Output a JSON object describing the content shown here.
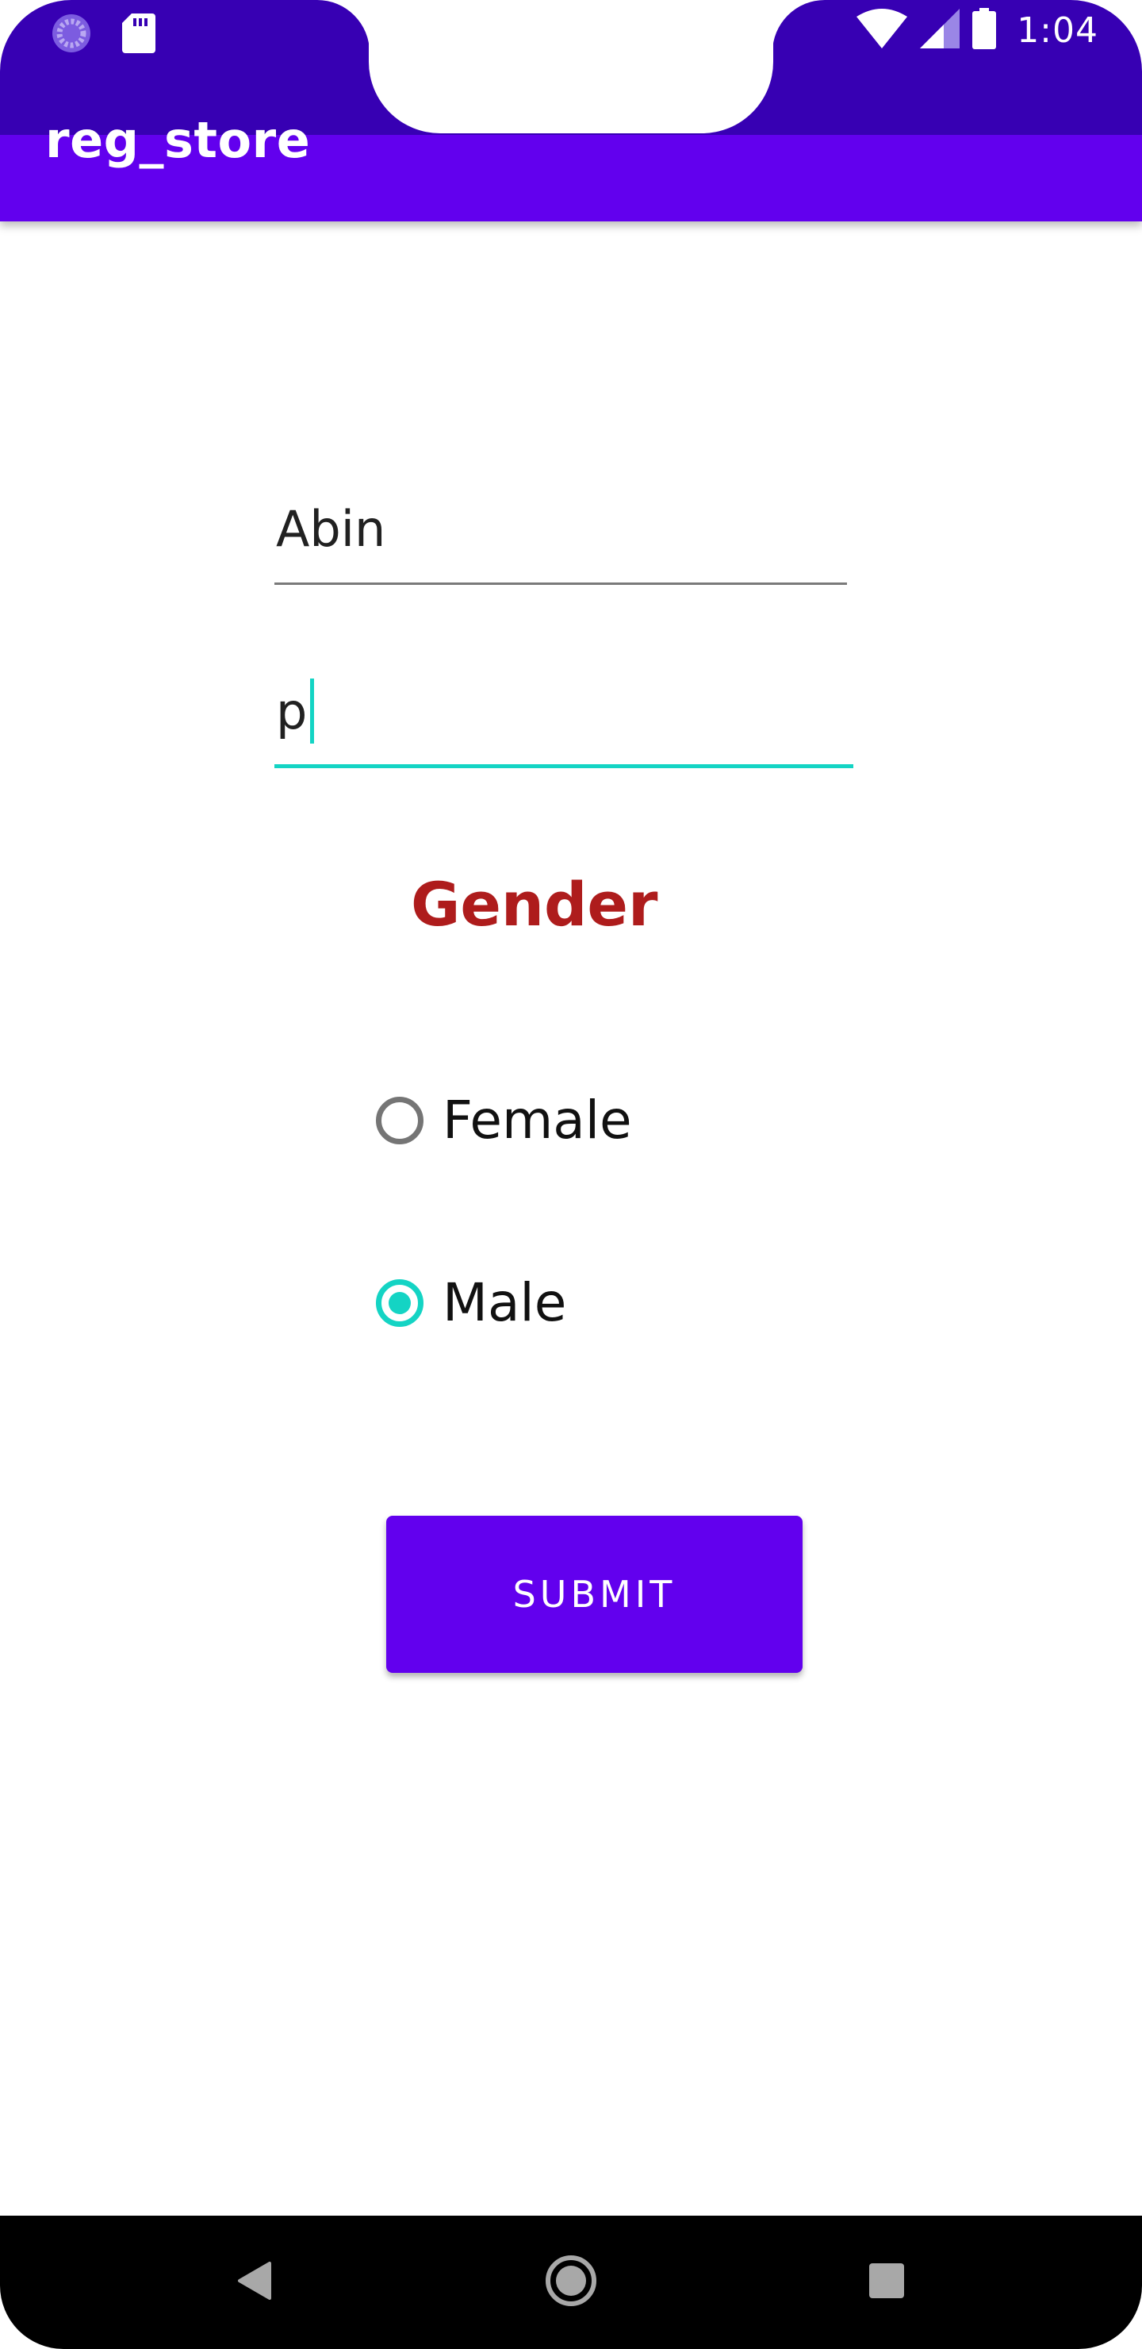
{
  "status_bar": {
    "time": "1:04",
    "icons": [
      "loading-icon",
      "sd-card-icon",
      "wifi-icon",
      "signal-icon",
      "battery-icon"
    ]
  },
  "app_bar": {
    "title": "reg_store"
  },
  "form": {
    "name_value": "Abin",
    "password_value": "p",
    "gender_label": "Gender",
    "options": [
      {
        "label": "Female",
        "checked": false
      },
      {
        "label": "Male",
        "checked": true
      }
    ],
    "submit_label": "SUBMIT"
  },
  "nav_bar": {
    "icons": [
      "back-icon",
      "home-icon",
      "recents-icon"
    ]
  },
  "colors": {
    "primary": "#6200ee",
    "primary_dark": "#3700b3",
    "accent": "#14d4c4",
    "gender_label": "#ae1c1c"
  }
}
